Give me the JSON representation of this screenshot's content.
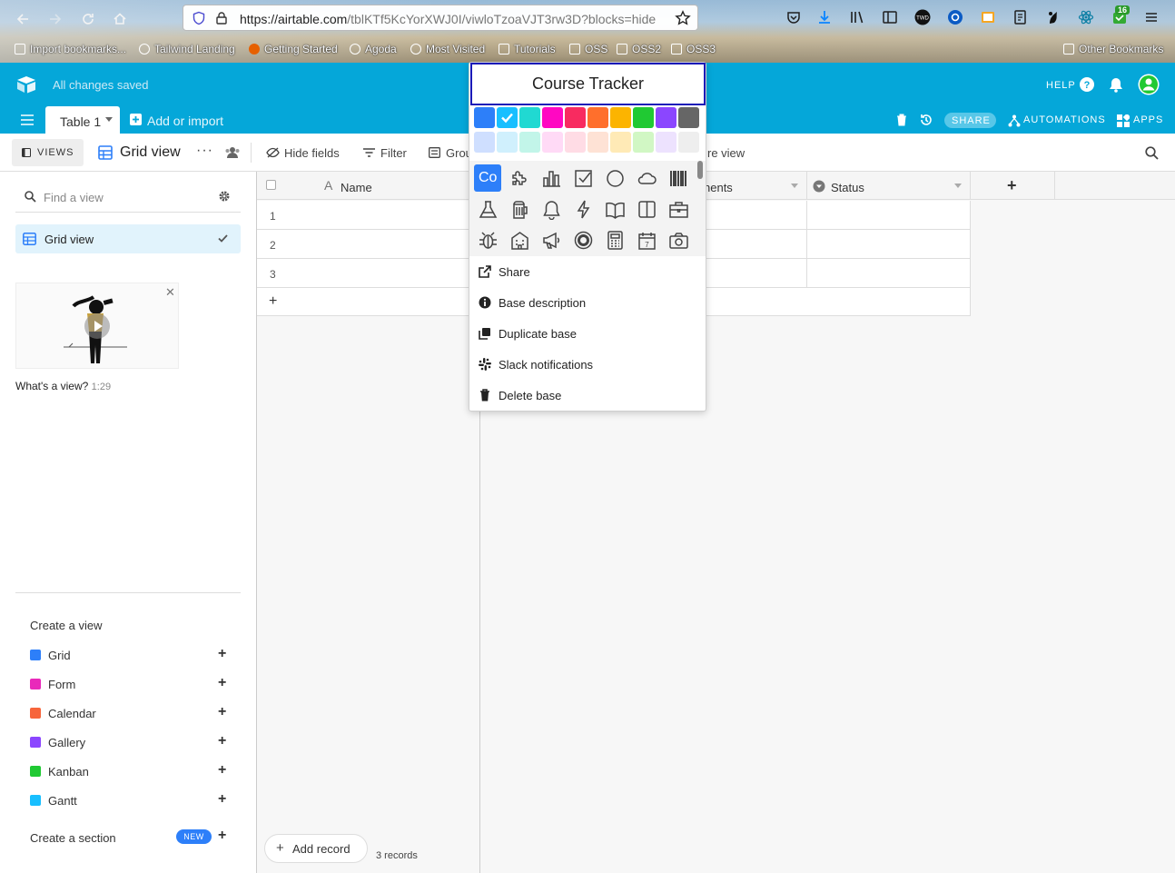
{
  "browser": {
    "url_host": "https://airtable.com",
    "url_path": "/tblKTf5KcYorXWJ0I/viwloTzoaVJT3rw3D?blocks=hide",
    "badge_count": "16",
    "bookmarks": [
      "Import bookmarks...",
      "Tailwind Landing",
      "Getting Started",
      "Agoda",
      "Most Visited",
      "Tutorials",
      "OSS",
      "OSS2",
      "OSS3"
    ],
    "other_bookmarks": "Other Bookmarks"
  },
  "header": {
    "save_status": "All changes saved",
    "help": "HELP",
    "table_tab": "Table 1",
    "add_import": "Add or import",
    "share": "SHARE",
    "automations": "AUTOMATIONS",
    "apps": "APPS"
  },
  "viewbar": {
    "views": "VIEWS",
    "current_view": "Grid view",
    "hide_fields": "Hide fields",
    "filter": "Filter",
    "group": "Grou",
    "share_view": "re view"
  },
  "sidebar": {
    "find_placeholder": "Find a view",
    "active_view": "Grid view",
    "video_title": "What's a view?",
    "video_duration": "1:29",
    "create_view": "Create a view",
    "view_types": [
      {
        "label": "Grid",
        "color": "#2d7ff9"
      },
      {
        "label": "Form",
        "color": "#e929ba"
      },
      {
        "label": "Calendar",
        "color": "#f7653b"
      },
      {
        "label": "Gallery",
        "color": "#8b46ff"
      },
      {
        "label": "Kanban",
        "color": "#20c933"
      },
      {
        "label": "Gantt",
        "color": "#18bfff"
      }
    ],
    "create_section": "Create a section",
    "new_badge": "NEW"
  },
  "grid": {
    "columns": [
      "Name",
      "nents",
      "Status"
    ],
    "rows": [
      "1",
      "2",
      "3"
    ],
    "add_record": "Add record",
    "record_count": "3 records"
  },
  "popover": {
    "base_name": "Course Tracker",
    "icon_abbrev": "Co",
    "colors_top": [
      "#2d7ff9",
      "#18bfff",
      "#20d9d2",
      "#ff08c2",
      "#f82b60",
      "#ff6f2c",
      "#fcb400",
      "#20c933",
      "#8b46ff",
      "#666666"
    ],
    "colors_bottom": [
      "#cfdfff",
      "#d0f0fd",
      "#c2f5e9",
      "#ffdaf6",
      "#ffdce5",
      "#fee2d5",
      "#ffeab6",
      "#d1f7c4",
      "#ede2fe",
      "#eeeeee"
    ],
    "selected_color_index": 1,
    "icons": [
      "puzzle",
      "bar-chart",
      "checkbox",
      "circle",
      "cloud",
      "barcode",
      "flask",
      "beer",
      "bell",
      "lightning",
      "book-open",
      "book",
      "briefcase",
      "bug",
      "building",
      "megaphone",
      "target",
      "calculator",
      "calendar",
      "camera"
    ],
    "menu": [
      {
        "label": "Share",
        "icon": "share"
      },
      {
        "label": "Base description",
        "icon": "info"
      },
      {
        "label": "Duplicate base",
        "icon": "duplicate"
      },
      {
        "label": "Slack notifications",
        "icon": "slack"
      },
      {
        "label": "Delete base",
        "icon": "trash"
      }
    ]
  }
}
